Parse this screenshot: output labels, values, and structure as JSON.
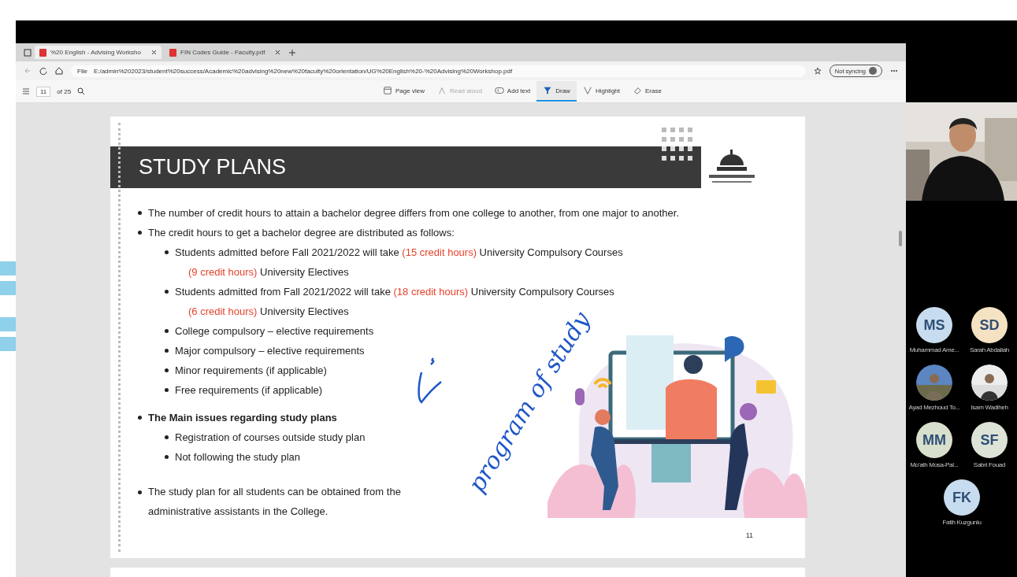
{
  "browser": {
    "tabs": [
      {
        "title": "%20 English - Advising Worksho",
        "selected": true
      },
      {
        "title": "FIN Codes Guide - Faculty.pdf",
        "selected": false
      }
    ],
    "scheme": "File",
    "url": "E:/admin%202023/student%20success/Academic%20advising%20new%20faculty%20orientation/UG%20English%20-%20Advising%20Workshop.pdf",
    "profile": "Not syncing"
  },
  "pdf_toolbar": {
    "page": "11",
    "page_count": "of 25",
    "tools": [
      {
        "kind": "page",
        "label": "Page view",
        "selected": false,
        "disabled": false
      },
      {
        "kind": "read",
        "label": "Read aloud",
        "selected": false,
        "disabled": true
      },
      {
        "kind": "text",
        "label": "Add text",
        "selected": false,
        "disabled": false
      },
      {
        "kind": "draw",
        "label": "Draw",
        "selected": true,
        "disabled": false
      },
      {
        "kind": "highlight",
        "label": "Highlight",
        "selected": false,
        "disabled": false
      },
      {
        "kind": "erase",
        "label": "Erase",
        "selected": false,
        "disabled": false
      }
    ]
  },
  "slide": {
    "title": "STUDY PLANS",
    "page_number": "11",
    "bullets": [
      {
        "parts": [
          {
            "text": "The number of credit hours to attain a bachelor degree differs from one college to another, from one major to another.",
            "red": false
          }
        ]
      },
      {
        "parts": [
          {
            "text": "The credit hours to get a bachelor degree are distributed as follows:",
            "red": false
          }
        ],
        "children": [
          {
            "parts": [
              {
                "text": "Students admitted before Fall 2021/2022 will take ",
                "red": false
              },
              {
                "text": "(15 credit hours)",
                "red": true
              },
              {
                "text": " University Compulsory Courses",
                "red": false
              }
            ],
            "continuation": [
              {
                "text": "(9 credit hours)",
                "red": true
              },
              {
                "text": " University Electives",
                "red": false
              }
            ]
          },
          {
            "parts": [
              {
                "text": "Students admitted from Fall 2021/2022 will take ",
                "red": false
              },
              {
                "text": "(18 credit hours)",
                "red": true
              },
              {
                "text": " University Compulsory Courses",
                "red": false
              }
            ],
            "continuation": [
              {
                "text": "(6 credit hours)",
                "red": true
              },
              {
                "text": " University Electives",
                "red": false
              }
            ]
          },
          {
            "parts": [
              {
                "text": "College compulsory – elective requirements",
                "red": false
              }
            ]
          },
          {
            "parts": [
              {
                "text": "Major compulsory – elective requirements",
                "red": false
              }
            ]
          },
          {
            "parts": [
              {
                "text": "Minor requirements (if applicable)",
                "red": false
              }
            ]
          },
          {
            "parts": [
              {
                "text": "Free requirements (if applicable)",
                "red": false
              }
            ]
          }
        ]
      },
      {
        "bold": true,
        "parts": [
          {
            "text": "The Main issues regarding study plans",
            "red": false
          }
        ],
        "children": [
          {
            "parts": [
              {
                "text": "Registration of courses outside study plan",
                "red": false
              }
            ]
          },
          {
            "parts": [
              {
                "text": "Not following the study plan",
                "red": false
              }
            ]
          }
        ]
      },
      {
        "parts": [
          {
            "text": "The study plan for all students can be obtained from the administrative assistants in the College.",
            "red": false
          }
        ]
      }
    ],
    "annotation": "program of study"
  },
  "participants": [
    {
      "kind": "initials",
      "initials": "MS",
      "name": "Muhammad Ame...",
      "color": "#c8dcef"
    },
    {
      "kind": "initials",
      "initials": "SD",
      "name": "Sarah Abdallah",
      "color": "#f5e2c2"
    },
    {
      "name": "Ayad Mezhoud To..."
    },
    {
      "name": "Isam Wadiheh"
    },
    {
      "kind": "initials",
      "initials": "MM",
      "name": "Mo'ath Mosa-Pal...",
      "color": "#d8dfcd"
    },
    {
      "kind": "initials",
      "initials": "SF",
      "name": "Sabri Fouad",
      "color": "#dde3d6"
    },
    {
      "kind": "initials",
      "initials": "FK",
      "name": "Fatih Kuzgunlu",
      "color": "#c8dcef"
    }
  ]
}
